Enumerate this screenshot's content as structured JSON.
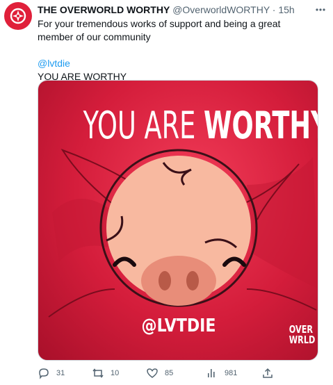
{
  "tweet": {
    "display_name": "THE OVERWORLD WORTHY",
    "handle": "@OverworldWORTHY",
    "separator": "·",
    "time": "15h",
    "text_line1": "For your tremendous works of support and being a great member of our community",
    "mention": "@lvtdie",
    "text_line3": "YOU ARE WORTHY"
  },
  "media": {
    "headline_regular": "YOU ARE ",
    "headline_bold": "WORTHY",
    "tag": "@LVTDIE",
    "logo_line1": "OVER",
    "logo_line2": "WRLD"
  },
  "actions": {
    "replies": "31",
    "retweets": "10",
    "likes": "85",
    "views": "981"
  },
  "icons": [
    "more-icon",
    "reply-icon",
    "retweet-icon",
    "like-icon",
    "views-icon",
    "share-icon"
  ],
  "colors": {
    "brand": "#e0203a",
    "mention": "#1d9bf0",
    "muted": "#536471"
  }
}
